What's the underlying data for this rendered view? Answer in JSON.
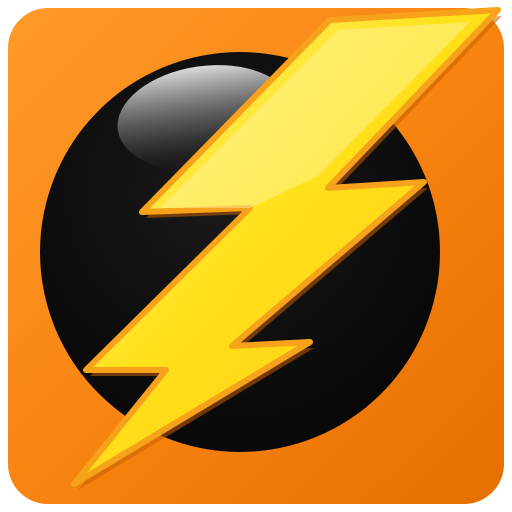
{
  "app_icon": {
    "icon": "lightning-bolt-icon",
    "colors": {
      "tile_orange": "#F7820F",
      "tile_orange_light": "#FF9A2A",
      "tile_orange_dark": "#E56F00",
      "circle_black": "#060606",
      "bolt_yellow": "#FFE11A",
      "bolt_yellow_light": "#FFF58A",
      "bolt_edge": "#F6A21A",
      "bolt_shadow": "#C85F00"
    }
  }
}
